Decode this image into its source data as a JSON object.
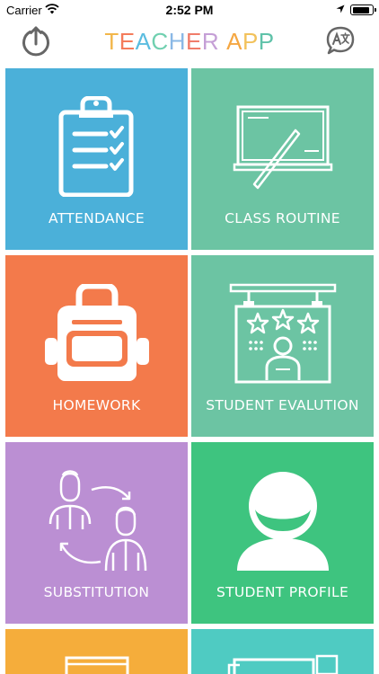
{
  "status_bar": {
    "carrier": "Carrier",
    "time": "2:52 PM",
    "battery_level": 0.9
  },
  "header": {
    "title": "TEACHER APP",
    "title_colors": [
      "#f2b64a",
      "#f47b5b",
      "#5bbde0",
      "#70d0b0",
      "#8ab8e6",
      "#f07c6a",
      "#c59fd6",
      "#f5a742",
      "#f2c25c",
      "#5fc2a9",
      "#8fb7ea"
    ],
    "left_icon": "upload-icon",
    "right_icon": "translate-icon"
  },
  "tiles": [
    {
      "label": "ATTENDANCE",
      "color": "#4bb0d9",
      "icon": "clipboard-checklist-icon"
    },
    {
      "label": "CLASS ROUTINE",
      "color": "#6cc4a3",
      "icon": "blackboard-icon"
    },
    {
      "label": "HOMEWORK",
      "color": "#f37a4b",
      "icon": "backpack-icon"
    },
    {
      "label": "STUDENT EVALUTION",
      "color": "#6cc4a3",
      "icon": "star-board-icon"
    },
    {
      "label": "SUBSTITUTION",
      "color": "#bb8fd3",
      "icon": "swap-people-icon"
    },
    {
      "label": "STUDENT PROFILE",
      "color": "#3ec47f",
      "icon": "user-profile-icon"
    },
    {
      "label": "",
      "color": "#f5ad3b",
      "icon": "book-icon"
    },
    {
      "label": "",
      "color": "#4fcbc2",
      "icon": "document-icon"
    }
  ]
}
